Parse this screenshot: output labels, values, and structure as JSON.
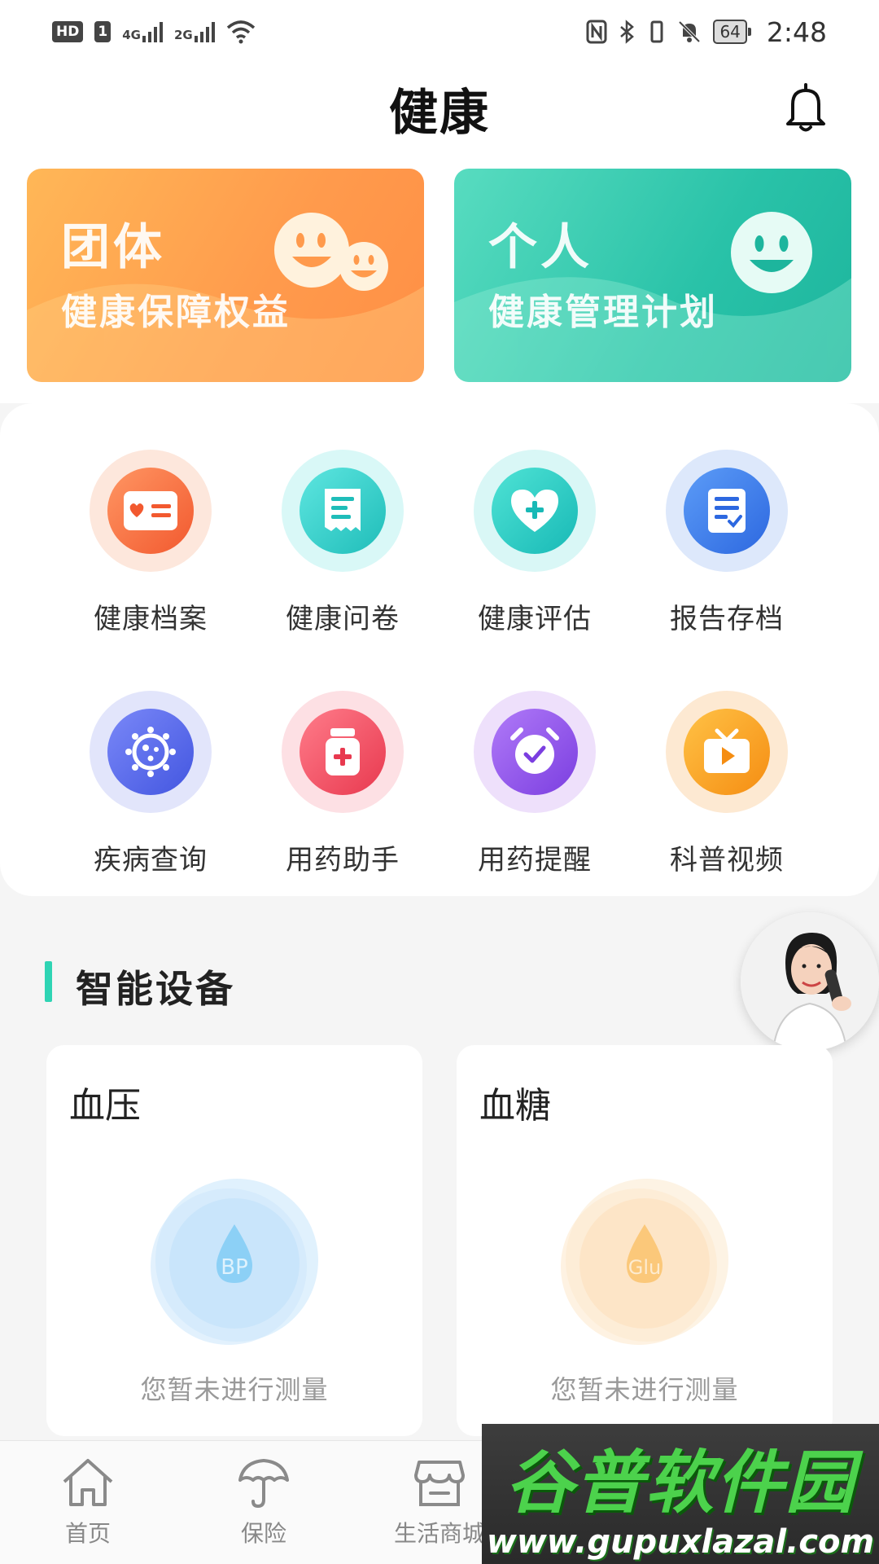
{
  "status_bar": {
    "hd": "HD",
    "sim": "1",
    "net1": "4G",
    "net2": "2G",
    "battery": "64",
    "time": "2:48"
  },
  "header": {
    "title": "健康",
    "bell_icon": "bell-icon"
  },
  "banners": [
    {
      "line1": "团体",
      "line2": "健康保障权益",
      "color": "#ff9a4c"
    },
    {
      "line1": "个人",
      "line2": "健康管理计划",
      "color": "#29c2a8"
    }
  ],
  "grid": [
    {
      "label": "健康档案",
      "icon": "id-card-icon"
    },
    {
      "label": "健康问卷",
      "icon": "questionnaire-icon"
    },
    {
      "label": "健康评估",
      "icon": "heart-plus-icon"
    },
    {
      "label": "报告存档",
      "icon": "report-icon"
    },
    {
      "label": "疾病查询",
      "icon": "virus-icon"
    },
    {
      "label": "用药助手",
      "icon": "medicine-bottle-icon"
    },
    {
      "label": "用药提醒",
      "icon": "alarm-clock-icon"
    },
    {
      "label": "科普视频",
      "icon": "tv-play-icon"
    }
  ],
  "section": {
    "title": "智能设备"
  },
  "devices": [
    {
      "name": "血压",
      "badge": "BP",
      "hint": "您暂未进行测量",
      "color": "#7cc8f5"
    },
    {
      "name": "血糖",
      "badge": "Glu",
      "hint": "您暂未进行测量",
      "color": "#fbc87a"
    }
  ],
  "bottom_nav": [
    {
      "label": "首页",
      "icon": "home-icon"
    },
    {
      "label": "保险",
      "icon": "umbrella-icon"
    },
    {
      "label": "生活商城",
      "icon": "store-icon"
    }
  ],
  "watermark": {
    "text": "谷普软件园",
    "url": "www.gupuxlazal.com"
  }
}
